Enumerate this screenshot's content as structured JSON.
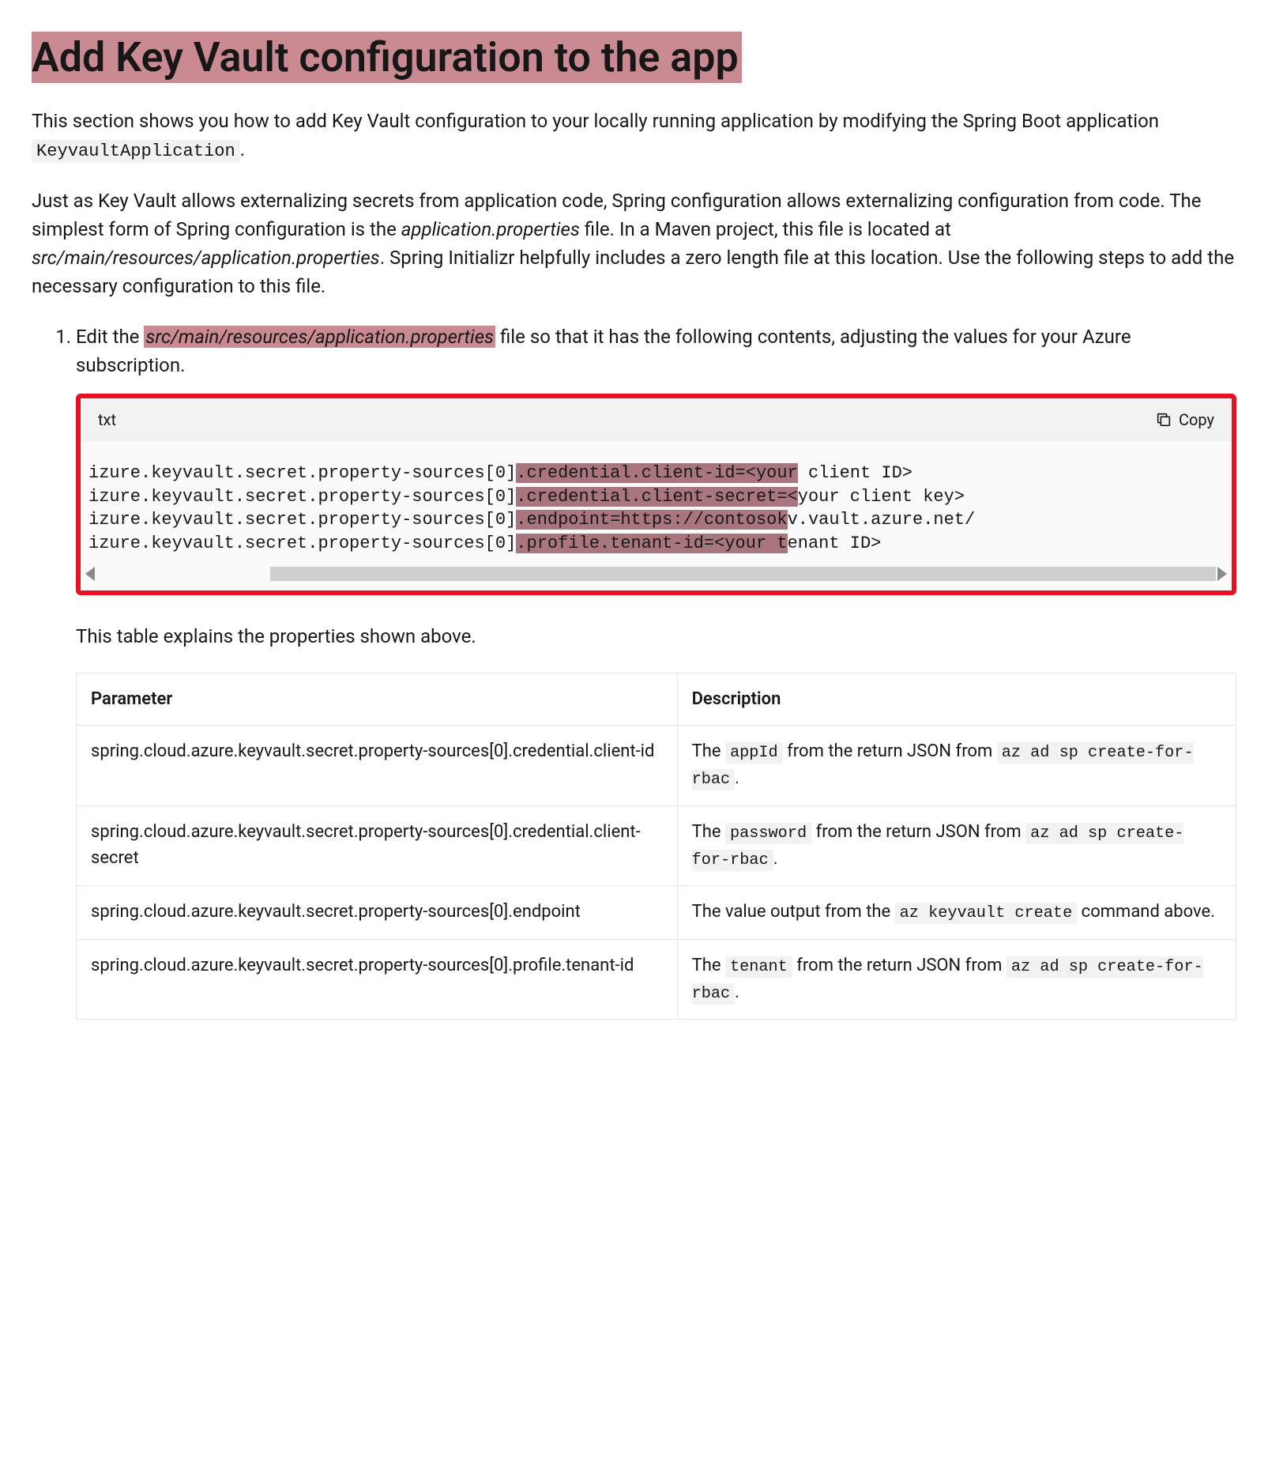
{
  "title": "Add Key Vault configuration to the app",
  "intro": {
    "pre": "This section shows you how to add Key Vault configuration to your locally running application by modifying the Spring Boot application ",
    "code": "KeyvaultApplication",
    "post": "."
  },
  "para2": {
    "a": "Just as Key Vault allows externalizing secrets from application code, Spring configuration allows externalizing configuration from code. The simplest form of Spring configuration is the ",
    "b": "application.properties",
    "c": " file. In a Maven project, this file is located at ",
    "d": "src/main/resources/application.properties",
    "e": ". Spring Initializr helpfully includes a zero length file at this location. Use the following steps to add the necessary configuration to this file."
  },
  "step1": {
    "a": "Edit the ",
    "b": "src/main/resources/application.properties",
    "c": " file so that it has the following contents, adjusting the values for your Azure subscription."
  },
  "code": {
    "lang": "txt",
    "copy": "Copy",
    "l1a": "izure.keyvault.secret.property-sources[0]",
    "l1b": ".credential.client-id=<your",
    "l1c": " client ID>",
    "l2a": "izure.keyvault.secret.property-sources[0]",
    "l2b": ".credential.client-secret=<",
    "l2c": "your client key>",
    "l3a": "izure.keyvault.secret.property-sources[0]",
    "l3b": ".endpoint=https://contosok",
    "l3c": "v.vault.azure.net/",
    "l4a": "izure.keyvault.secret.property-sources[0]",
    "l4b": ".profile.tenant-id=<your t",
    "l4c": "enant ID>"
  },
  "tableIntro": "This table explains the properties shown above.",
  "table": {
    "h1": "Parameter",
    "h2": "Description",
    "rows": [
      {
        "param": "spring.cloud.azure.keyvault.secret.property-sources[0].credential.client-id",
        "d1": "The ",
        "c1": "appId",
        "d2": " from the return JSON from ",
        "c2": "az ad sp create-for-rbac",
        "d3": "."
      },
      {
        "param": "spring.cloud.azure.keyvault.secret.property-sources[0].credential.client-secret",
        "d1": "The ",
        "c1": "password",
        "d2": " from the return JSON from ",
        "c2": "az ad sp create-for-rbac",
        "d3": "."
      },
      {
        "param": "spring.cloud.azure.keyvault.secret.property-sources[0].endpoint",
        "d1": "The value output from the ",
        "c1": "az keyvault create",
        "d2": " command above.",
        "c2": "",
        "d3": ""
      },
      {
        "param": "spring.cloud.azure.keyvault.secret.property-sources[0].profile.tenant-id",
        "d1": "The ",
        "c1": "tenant",
        "d2": " from the return JSON from ",
        "c2": "az ad sp create-for-rbac",
        "d3": "."
      }
    ]
  }
}
